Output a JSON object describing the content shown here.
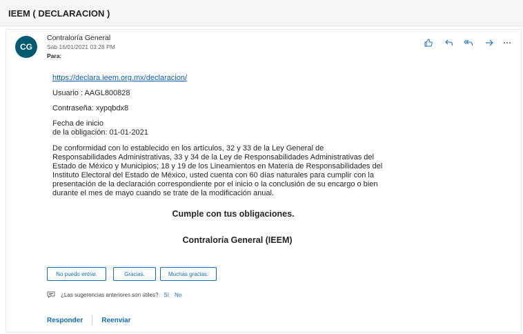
{
  "subject": "IEEM ( DECLARACION )",
  "message": {
    "avatar_initials": "CG",
    "avatar_color": "#005a70",
    "sender": "Contraloría General",
    "date": "Sáb 16/01/2021 03:28 PM",
    "to_label": "Para:",
    "actions": [
      "like-icon",
      "reply-icon",
      "reply-all-icon",
      "forward-icon",
      "more-icon"
    ]
  },
  "body": {
    "link": "https://declara.ieem.org.mx/declaracion/",
    "usuario": "Usuario : AAGL800828",
    "contrasena": "Contraseña: xypqbdx8",
    "fecha": "Fecha de inicio\nde la obligación: 01-01-2021",
    "paragraph": "De conformidad con lo establecido en los artículos, 32 y 33 de la Ley General de\nResponsabilidades Administrativas, 33 y 34 de la Ley de Responsabilidades Administrativas del\nEstado de México y Municipios; 18 y 19 de los Lineamientos en Materia de Responsabilidades del\nInstituto Electoral del Estado de México, usted cuenta con 60 días naturales para cumplir con la\npresentación de la declaración correspondiente por el inicio o la conclusión de su encargo o bien\ndurante el mes de mayo cuando se trate de la modificación anual.",
    "bold1": "Cumple con tus obligaciones.",
    "bold2": "Contraloría General (IEEM)"
  },
  "suggested_replies": [
    "No puedo entrar.",
    "Gracias.",
    "Muchas gracias."
  ],
  "feedback": {
    "question": "¿Las sugerencias anteriores son útiles?",
    "yes": "Sí",
    "no": "No"
  },
  "footer": {
    "reply": "Responder",
    "forward": "Reenviar"
  },
  "colors": {
    "accent": "#0f6cbd",
    "link": "#0b5cad"
  }
}
